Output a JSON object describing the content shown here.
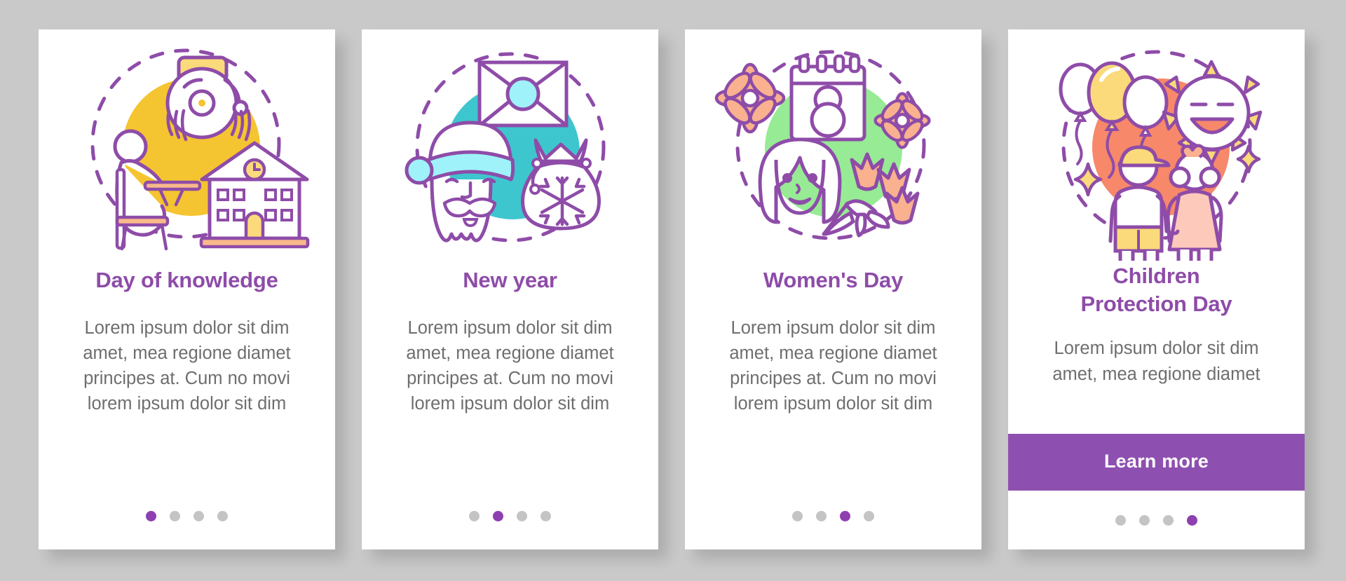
{
  "background_color": "#c9c9c9",
  "accent_color": "#8e4ca8",
  "button_color": "#8e50b0",
  "dot_active_color": "#8e3fb0",
  "dot_inactive_color": "#c4c4c4",
  "body_text_color": "#6e6e6e",
  "cards": [
    {
      "title": "Day of knowledge",
      "body": "Lorem ipsum dolor sit dim amet, mea regione diamet principes at. Cum no movi lorem ipsum dolor sit dim",
      "illustration": "school-desk-bell-house-icon",
      "illustration_accent": "#f5c431",
      "dots_total": 4,
      "dots_active_index": 0,
      "cta_label": null
    },
    {
      "title": "New year",
      "body": "Lorem ipsum dolor sit dim amet, mea regione diamet principes at. Cum no movi lorem ipsum dolor sit dim",
      "illustration": "santa-envelope-giftsack-icon",
      "illustration_accent": "#3ec6cf",
      "dots_total": 4,
      "dots_active_index": 1,
      "cta_label": null
    },
    {
      "title": "Women's Day",
      "body": "Lorem ipsum dolor sit dim amet, mea regione diamet principes at. Cum no movi lorem ipsum dolor sit dim",
      "illustration": "woman-calendar-flowers-icon",
      "illustration_accent": "#97eb94",
      "dots_total": 4,
      "dots_active_index": 2,
      "cta_label": null
    },
    {
      "title": "Children\nProtection Day",
      "body": "Lorem ipsum dolor sit dim amet, mea regione diamet",
      "illustration": "children-balloons-sun-icon",
      "illustration_accent": "#f7886a",
      "dots_total": 4,
      "dots_active_index": 3,
      "cta_label": "Learn more"
    }
  ]
}
